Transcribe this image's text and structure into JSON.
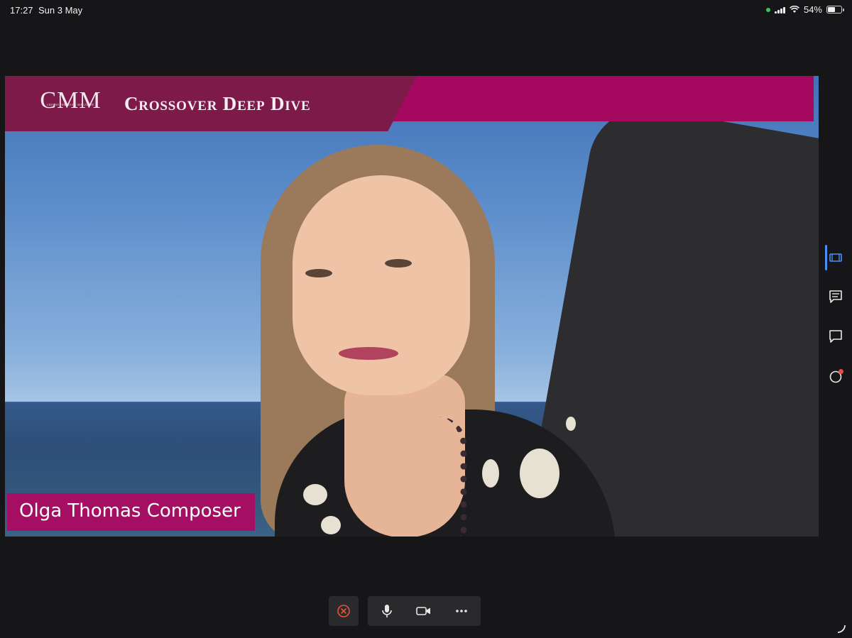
{
  "status_bar": {
    "time": "17:27",
    "date": "Sun 3 May",
    "battery_percent": "54%",
    "battery_level": 0.54,
    "camera_indicator_color": "#34c759"
  },
  "video": {
    "banner": {
      "logo_text": "CMM",
      "logo_subtext": "CROSSOVER MUSIC MAGAZINE",
      "title": "Crossover Deep Dive",
      "primary_color": "#a4085f",
      "secondary_color": "#7e1a4a"
    },
    "name_tag": "Olga Thomas Composer",
    "name_tag_color": "#a40f63"
  },
  "side_rail": {
    "items": [
      {
        "icon": "filmstrip-icon",
        "active": true
      },
      {
        "icon": "chat-list-icon",
        "active": false
      },
      {
        "icon": "comment-icon",
        "active": false
      },
      {
        "icon": "activity-icon",
        "active": false,
        "notification": true
      }
    ],
    "active_color": "#4a8ff5"
  },
  "controls": {
    "leave_icon": "close-circle-icon",
    "leave_color": "#e8503a",
    "mic_icon": "microphone-icon",
    "camera_icon": "video-camera-icon",
    "more_icon": "more-dots-icon"
  }
}
